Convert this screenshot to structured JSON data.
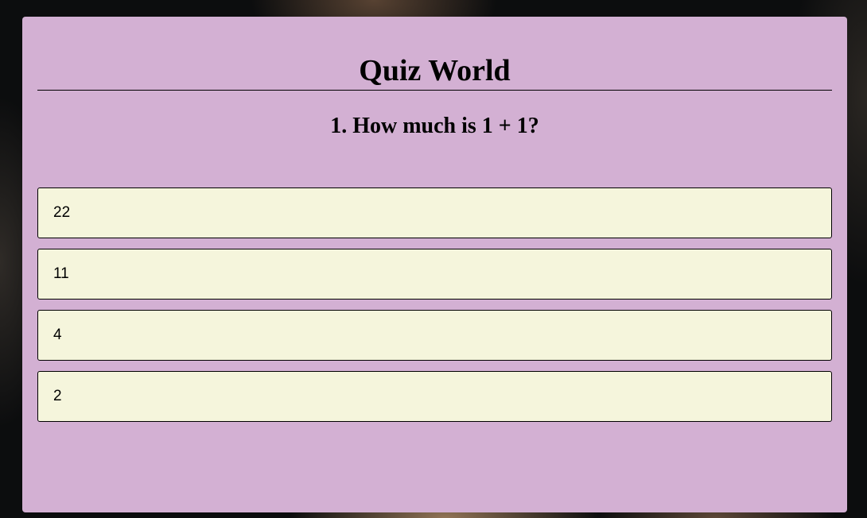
{
  "quiz": {
    "title": "Quiz World",
    "question": "1. How much is 1 + 1?",
    "answers": [
      {
        "label": "22"
      },
      {
        "label": "11"
      },
      {
        "label": "4"
      },
      {
        "label": "2"
      }
    ]
  },
  "colors": {
    "card_background": "#d3b0d3",
    "answer_background": "#f5f5dc",
    "text": "#000000"
  }
}
